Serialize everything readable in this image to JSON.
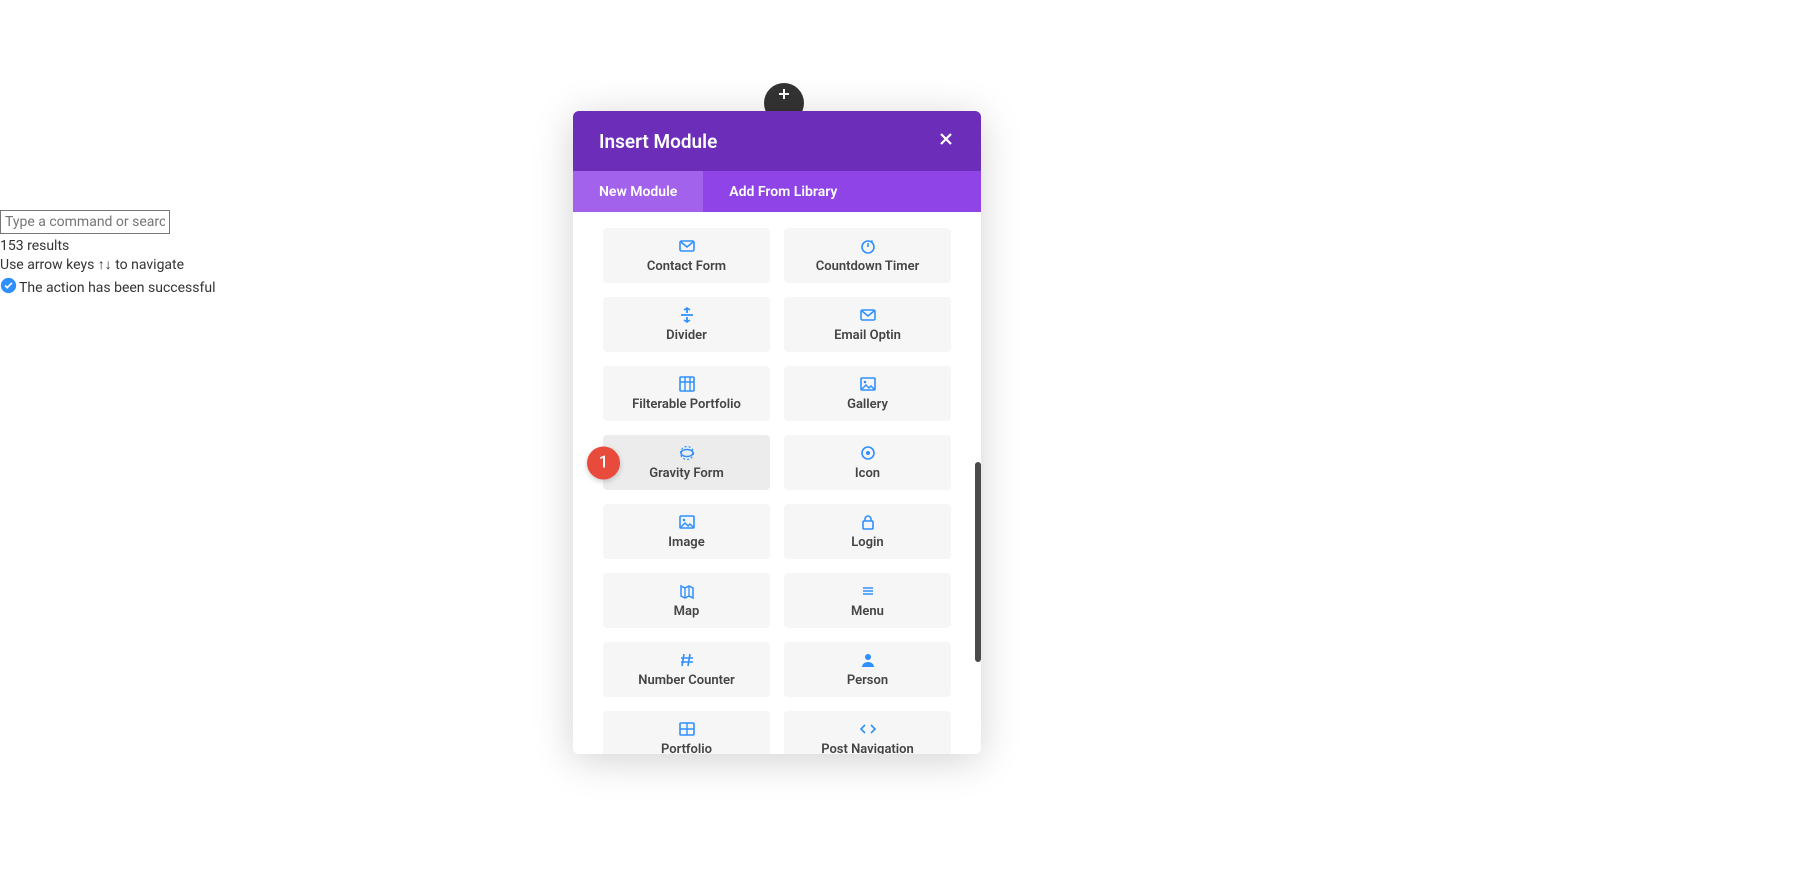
{
  "sidepanel": {
    "input_placeholder": "Type a command or search",
    "results": "153 results",
    "nav_hint": "Use arrow keys ↑↓ to navigate",
    "status": "The action has been successful"
  },
  "modal": {
    "title": "Insert Module",
    "tabs": {
      "new": "New Module",
      "library": "Add From Library"
    }
  },
  "modules": [
    {
      "label": "Contact Form",
      "icon": "mail"
    },
    {
      "label": "Countdown Timer",
      "icon": "timer"
    },
    {
      "label": "Divider",
      "icon": "divider"
    },
    {
      "label": "Email Optin",
      "icon": "mail"
    },
    {
      "label": "Filterable Portfolio",
      "icon": "grid"
    },
    {
      "label": "Gallery",
      "icon": "image"
    },
    {
      "label": "Gravity Form",
      "icon": "gravity",
      "hover": true,
      "badge": "1"
    },
    {
      "label": "Icon",
      "icon": "target"
    },
    {
      "label": "Image",
      "icon": "image"
    },
    {
      "label": "Login",
      "icon": "lock"
    },
    {
      "label": "Map",
      "icon": "map"
    },
    {
      "label": "Menu",
      "icon": "menu"
    },
    {
      "label": "Number Counter",
      "icon": "hash"
    },
    {
      "label": "Person",
      "icon": "person"
    },
    {
      "label": "Portfolio",
      "icon": "cells"
    },
    {
      "label": "Post Navigation",
      "icon": "code"
    }
  ],
  "colors": {
    "accent": "#2f8fff",
    "headerPurple": "#6c2eb9",
    "tabPurple": "#8e44e6",
    "badgeRed": "#e84b3c"
  }
}
